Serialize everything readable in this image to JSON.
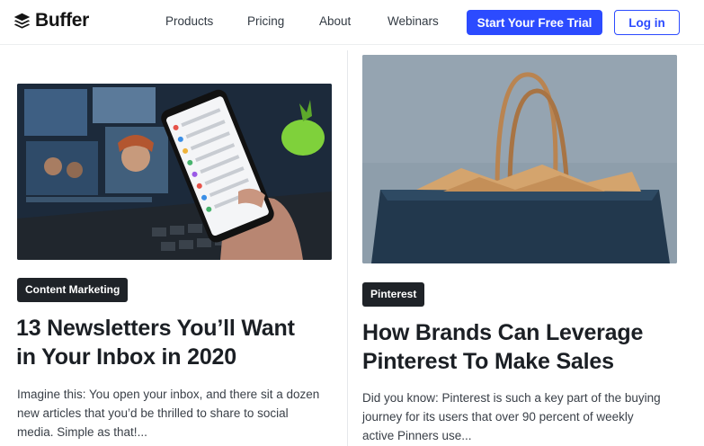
{
  "header": {
    "brand": "Buffer",
    "nav": [
      "Products",
      "Pricing",
      "About",
      "Webinars"
    ],
    "cta_label": "Start Your Free Trial",
    "login_label": "Log in"
  },
  "colors": {
    "accent": "#2c4bff",
    "tag_bg": "#1f2328",
    "text": "#1b1f24"
  },
  "posts": [
    {
      "tag": "Content Marketing",
      "title_lines": [
        "13 Newsletters You’ll Want",
        "in Your Inbox in 2020"
      ],
      "excerpt_lines": [
        "Imagine this: You open your inbox, and there sit a dozen",
        "new articles that you’d be thrilled to share to social",
        "media. Simple as that!..."
      ]
    },
    {
      "tag": "Pinterest",
      "title_lines": [
        "How Brands Can Leverage",
        "Pinterest To Make Sales"
      ],
      "excerpt_lines": [
        "Did you know: Pinterest is such a key part of the buying",
        "journey for its users that over 90 percent of weekly",
        "active Pinners use..."
      ]
    }
  ]
}
